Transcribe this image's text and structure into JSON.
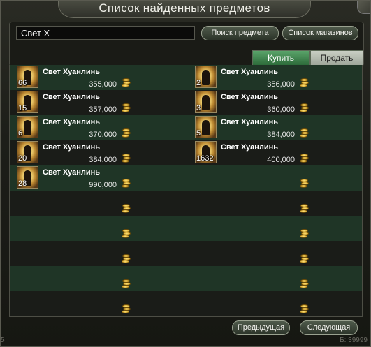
{
  "window": {
    "title": "Список найденных предметов"
  },
  "search": {
    "value": "Свет Х",
    "search_button": "Поиск предмета",
    "shops_button": "Список магазинов"
  },
  "tabs": {
    "buy": "Купить",
    "sell": "Продать"
  },
  "listings": [
    {
      "name": "Свет Хуанлинь",
      "qty": "66",
      "price": "355,000"
    },
    {
      "name": "Свет Хуанлинь",
      "qty": "2",
      "price": "356,000"
    },
    {
      "name": "Свет Хуанлинь",
      "qty": "15",
      "price": "357,000"
    },
    {
      "name": "Свет Хуанлинь",
      "qty": "3",
      "price": "360,000"
    },
    {
      "name": "Свет Хуанлинь",
      "qty": "6",
      "price": "370,000"
    },
    {
      "name": "Свет Хуанлинь",
      "qty": "5",
      "price": "384,000"
    },
    {
      "name": "Свет Хуанлинь",
      "qty": "20",
      "price": "384,000"
    },
    {
      "name": "Свет Хуанлинь",
      "qty": "1632",
      "price": "400,000"
    },
    {
      "name": "Свет Хуанлинь",
      "qty": "28",
      "price": "990,000"
    }
  ],
  "pagination": {
    "prev": "Предыдущая",
    "next": "Следующая"
  },
  "footer": {
    "left": "5",
    "right": "Б: 39999"
  },
  "icons": {
    "currency": "gold-coin-stack-icon",
    "item": "light-huanlin-item-icon"
  },
  "colors": {
    "accent_green": "#2d6b3a",
    "row_odd": "#1f3526",
    "coin_gold": "#e0b030"
  }
}
